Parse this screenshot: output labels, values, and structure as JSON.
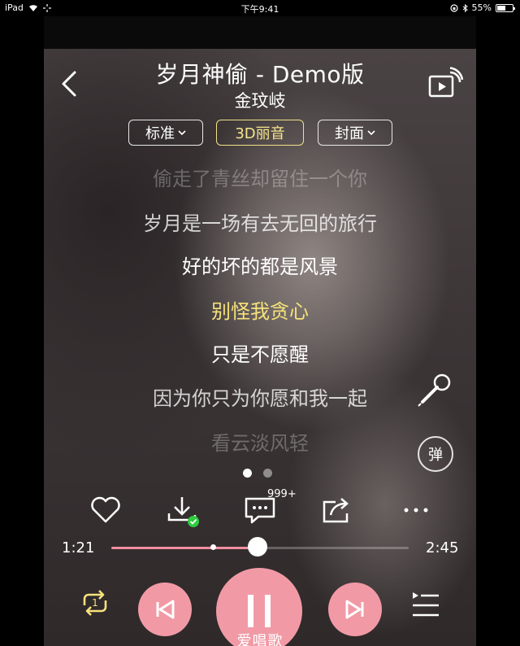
{
  "status_bar": {
    "device": "iPad",
    "time": "下午9:41",
    "battery": "55%",
    "battery_level": 0.55
  },
  "header": {
    "title": "岁月神偷 - Demo版",
    "artist": "金玟岐"
  },
  "modes": {
    "quality": "标准",
    "effect": "3D丽音",
    "cover": "封面"
  },
  "lyrics": [
    "偷走了青丝却留住一个你",
    "岁月是一场有去无回的旅行",
    "好的坏的都是风景",
    "别怪我贪心",
    "只是不愿醒",
    "因为你只为你愿和我一起",
    "看云淡风轻"
  ],
  "side_buttons": {
    "danmu": "弹"
  },
  "pager": {
    "pages": 2,
    "active": 1
  },
  "actions": {
    "comment_count": "999+"
  },
  "progress": {
    "current": "1:21",
    "total": "2:45",
    "played_fraction": 0.491,
    "buffered_fraction": 0.342
  },
  "watermark": "爱唱歌",
  "colors": {
    "accent_pink": "#f19aa6",
    "highlight_yellow": "#f6e27a",
    "download_ok_green": "#2ecc40"
  },
  "icons": [
    "back-icon",
    "cast-icon",
    "mic-icon",
    "heart-icon",
    "download-icon",
    "comment-icon",
    "share-icon",
    "more-icon",
    "repeat-icon",
    "prev-icon",
    "pause-icon",
    "next-icon",
    "queue-icon"
  ]
}
